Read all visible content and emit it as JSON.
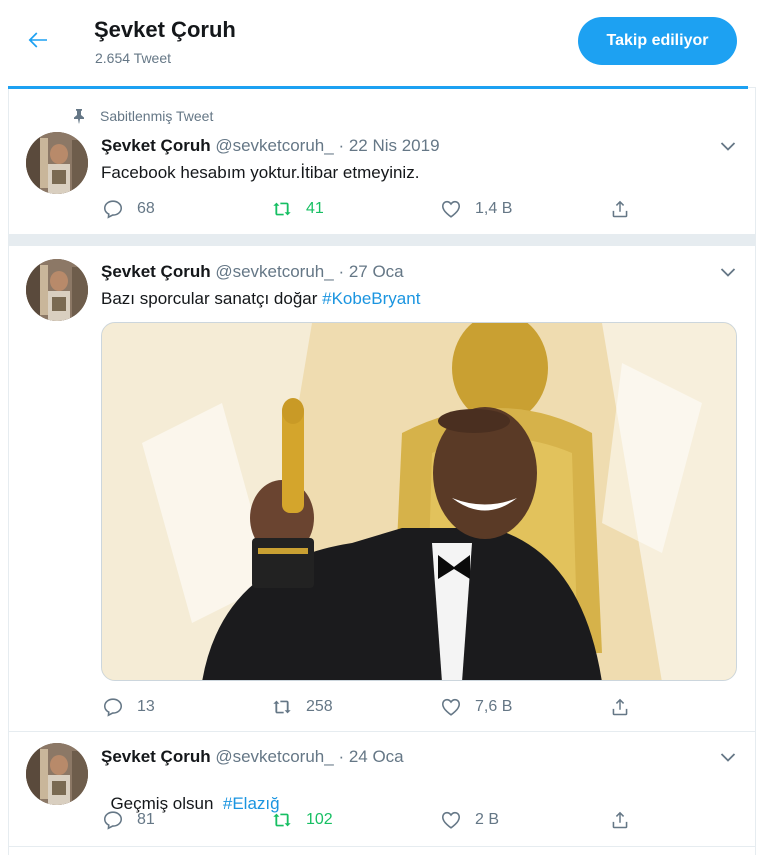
{
  "header": {
    "name": "Şevket Çoruh",
    "tweet_count": "2.654 Tweet",
    "follow_label": "Takip ediliyor"
  },
  "pinned_label": "Sabitlenmiş Tweet",
  "tweets": [
    {
      "name": "Şevket Çoruh",
      "handle": "@sevketcoruh_",
      "date": "· 22 Nis 2019",
      "text": "Facebook hesabım yoktur.İtibar etmeyiniz.",
      "hashtag": "",
      "replies": "68",
      "retweets": "41",
      "likes": "1,4 B"
    },
    {
      "name": "Şevket Çoruh",
      "handle": "@sevketcoruh_",
      "date": "· 27 Oca",
      "text": "Bazı sporcular sanatçı doğar ",
      "hashtag": "#KobeBryant",
      "replies": "13",
      "retweets": "258",
      "likes": "7,6 B"
    },
    {
      "name": "Şevket Çoruh",
      "handle": "@sevketcoruh_",
      "date": "· 24 Oca",
      "text": "Geçmiş olsun  ",
      "hashtag": "#Elazığ",
      "replies": "81",
      "retweets": "102",
      "likes": "2 B"
    }
  ],
  "colors": {
    "accent": "#1da1f2",
    "retweet_active": "#17bf63",
    "muted": "#657786"
  }
}
